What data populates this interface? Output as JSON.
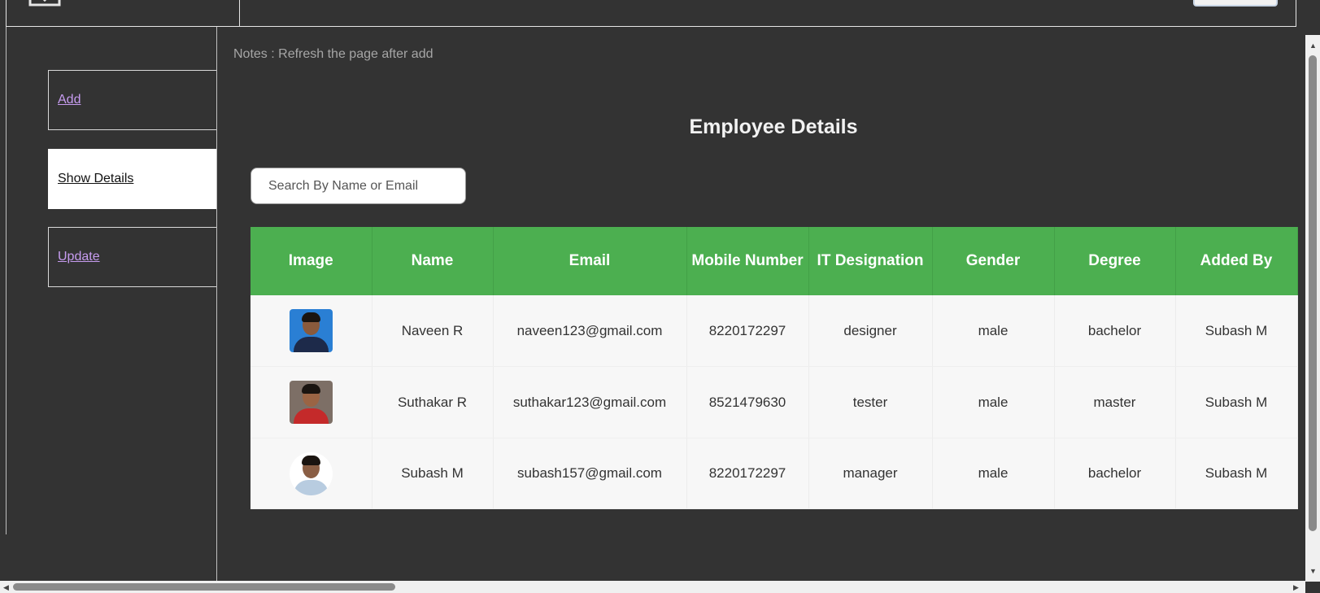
{
  "sidebar": {
    "items": [
      {
        "label": "Add"
      },
      {
        "label": "Show Details"
      },
      {
        "label": "Update"
      }
    ]
  },
  "notes": "Notes : Refresh the page after add",
  "title": "Employee Details",
  "search": {
    "placeholder": "Search By Name or Email",
    "value": ""
  },
  "table": {
    "headers": [
      "Image",
      "Name",
      "Email",
      "Mobile Number",
      "IT Designation",
      "Gender",
      "Degree",
      "Added By"
    ],
    "rows": [
      {
        "name": "Naveen R",
        "email": "naveen123@gmail.com",
        "mobile": "8220172297",
        "designation": "designer",
        "gender": "male",
        "degree": "bachelor",
        "added_by": "Subash M"
      },
      {
        "name": "Suthakar R",
        "email": "suthakar123@gmail.com",
        "mobile": "8521479630",
        "designation": "tester",
        "gender": "male",
        "degree": "master",
        "added_by": "Subash M"
      },
      {
        "name": "Subash M",
        "email": "subash157@gmail.com",
        "mobile": "8220172297",
        "designation": "manager",
        "gender": "male",
        "degree": "bachelor",
        "added_by": "Subash M"
      }
    ]
  },
  "colors": {
    "header_green": "#4caf50",
    "background": "#333333",
    "link_visited": "#c79cf0"
  },
  "icons": [
    "logo-icon",
    "employee-photo"
  ]
}
